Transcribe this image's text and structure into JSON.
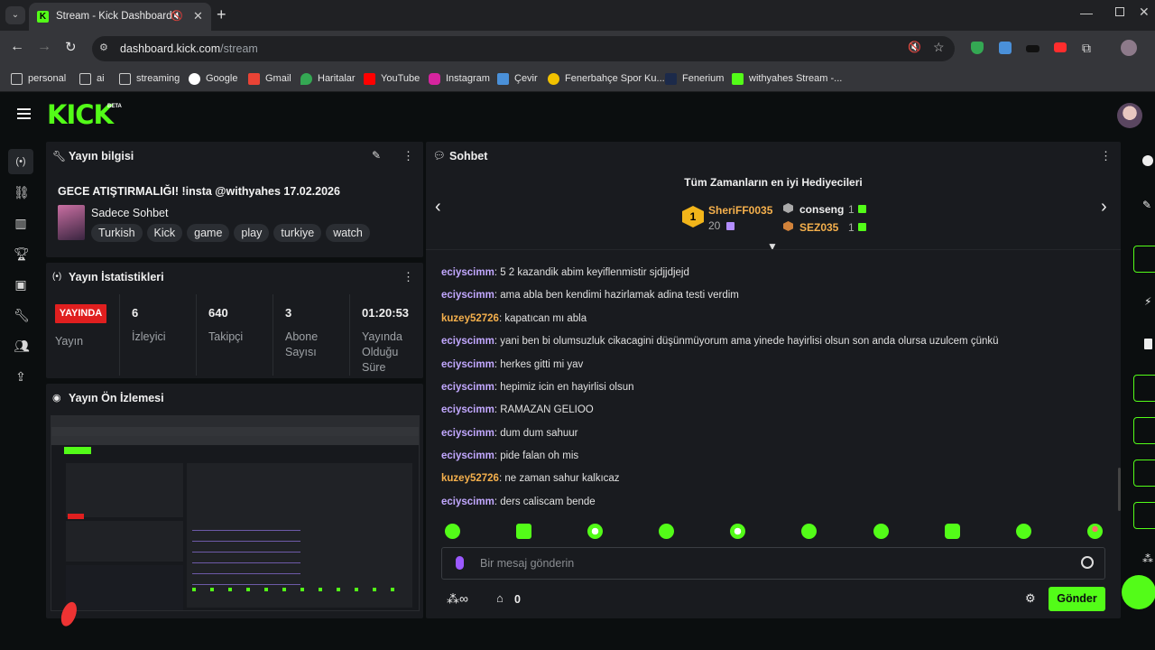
{
  "browser": {
    "tab_title": "Stream - Kick Dashboard",
    "url_host": "dashboard.kick.com",
    "url_path": "/stream",
    "bookmarks": [
      "personal",
      "ai",
      "streaming",
      "Google",
      "Gmail",
      "Haritalar",
      "YouTube",
      "Instagram",
      "Çevir",
      "Fenerbahçe Spor Ku...",
      "Fenerium",
      "withyahes Stream -..."
    ]
  },
  "app": {
    "logo": "KICK",
    "logo_badge": "BETA",
    "accent": "#53fc18"
  },
  "stream_info": {
    "title": "Yayın bilgisi",
    "stream_title": "GECE ATIŞTIRMALIĞI! !insta @withyahes 17.02.2026",
    "category": "Sadece Sohbet",
    "tags": [
      "Turkish",
      "Kick",
      "game",
      "play",
      "turkiye",
      "watch"
    ]
  },
  "stats": {
    "title": "Yayın İstatistikleri",
    "live_badge": "YAYINDA",
    "stream_label": "Yayın",
    "items": [
      {
        "value": "6",
        "label": "İzleyici"
      },
      {
        "value": "640",
        "label": "Takipçi"
      },
      {
        "value": "3",
        "label": "Abone Sayısı"
      },
      {
        "value": "01:20:53",
        "label": "Yayında Olduğu Süre"
      }
    ]
  },
  "preview": {
    "title": "Yayın Ön İzlemesi"
  },
  "chat": {
    "title": "Sohbet",
    "gifters_title": "Tüm Zamanların en iyi Hediyecileri",
    "top_gifter": {
      "rank": "1",
      "name": "SheriFF0035",
      "count": "20"
    },
    "gifter_2": {
      "name": "conseng",
      "count": "1"
    },
    "gifter_3": {
      "name": "SEZ035",
      "count": "1"
    },
    "messages": [
      {
        "user": "eciyscimm",
        "text": "5 2 kazandik abim keyiflenmistir sjdjjdjejd",
        "style": "u1"
      },
      {
        "user": "eciyscimm",
        "text": "ama abla ben kendimi hazirlamak adina testi verdim",
        "style": "u1"
      },
      {
        "user": "kuzey52726",
        "text": "kapatıcan mı abla",
        "style": "u2"
      },
      {
        "user": "eciyscimm",
        "text": "yani ben bi olumsuzluk cikacagini düşünmüyorum ama yinede hayirlisi olsun son anda olursa uzulcem çünkü",
        "style": "u1"
      },
      {
        "user": "eciyscimm",
        "text": "herkes gitti mi yav",
        "style": "u1"
      },
      {
        "user": "eciyscimm",
        "text": "hepimiz icin en hayirlisi olsun",
        "style": "u1"
      },
      {
        "user": "eciyscimm",
        "text": "RAMAZAN GELIOO",
        "style": "u1"
      },
      {
        "user": "eciyscimm",
        "text": "dum dum sahuur",
        "style": "u1"
      },
      {
        "user": "eciyscimm",
        "text": "pide falan oh mis",
        "style": "u1"
      },
      {
        "user": "kuzey52726",
        "text": "ne zaman sahur kalkıcaz",
        "style": "u2"
      },
      {
        "user": "eciyscimm",
        "text": "ders caliscam bende",
        "style": "u1"
      }
    ],
    "input_placeholder": "Bir mesaj gönderin",
    "points": "0",
    "send_label": "Gönder"
  }
}
